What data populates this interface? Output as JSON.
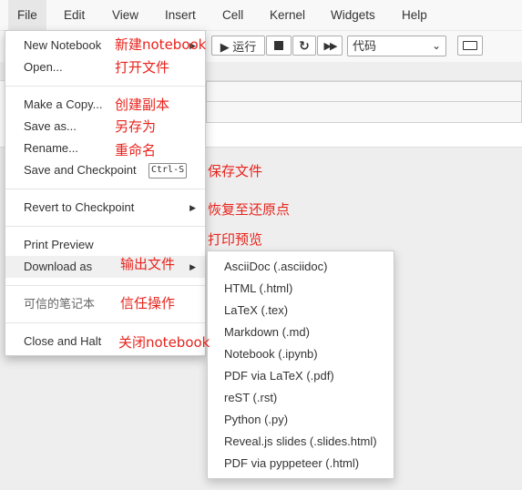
{
  "menubar": {
    "items": [
      {
        "label": "File"
      },
      {
        "label": "Edit"
      },
      {
        "label": "View"
      },
      {
        "label": "Insert"
      },
      {
        "label": "Cell"
      },
      {
        "label": "Kernel"
      },
      {
        "label": "Widgets"
      },
      {
        "label": "Help"
      }
    ]
  },
  "toolbar": {
    "run_label": "▶ 运行",
    "cell_type_value": "代码"
  },
  "file_menu": {
    "items": [
      {
        "label": "New Notebook"
      },
      {
        "label": "Open..."
      },
      {
        "label": "Make a Copy..."
      },
      {
        "label": "Save as..."
      },
      {
        "label": "Rename..."
      },
      {
        "label": "Save and Checkpoint",
        "shortcut": "Ctrl-S"
      },
      {
        "label": "Revert to Checkpoint"
      },
      {
        "label": "Print Preview"
      },
      {
        "label": "Download as"
      },
      {
        "label": "可信的笔记本"
      },
      {
        "label": "Close and Halt"
      }
    ]
  },
  "download_submenu": {
    "items": [
      {
        "label": "AsciiDoc (.asciidoc)"
      },
      {
        "label": "HTML (.html)"
      },
      {
        "label": "LaTeX (.tex)"
      },
      {
        "label": "Markdown (.md)"
      },
      {
        "label": "Notebook (.ipynb)"
      },
      {
        "label": "PDF via LaTeX (.pdf)"
      },
      {
        "label": "reST (.rst)"
      },
      {
        "label": "Python (.py)"
      },
      {
        "label": "Reveal.js slides (.slides.html)"
      },
      {
        "label": "PDF via pyppeteer (.html)"
      }
    ]
  },
  "annotations": [
    {
      "text": "新建notebook"
    },
    {
      "text": "打开文件"
    },
    {
      "text": "创建副本"
    },
    {
      "text": "另存为"
    },
    {
      "text": "重命名"
    },
    {
      "text": "保存文件"
    },
    {
      "text": "恢复至还原点"
    },
    {
      "text": "打印预览"
    },
    {
      "text": "输出文件"
    },
    {
      "text": "信任操作"
    },
    {
      "text": "关闭notebook"
    }
  ],
  "colors": {
    "annotation": "#e8231c",
    "menubar_bg": "#f8f8f8",
    "active_menu_bg": "#e7e7e7"
  }
}
